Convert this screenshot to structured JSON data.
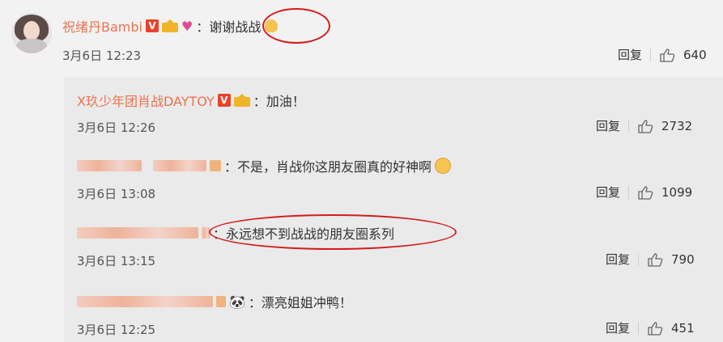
{
  "main": {
    "author": "祝绪丹Bambi",
    "text": "：谢谢战战",
    "time": "3月6日 12:23",
    "reply_label": "回复",
    "likes": "640"
  },
  "replies": [
    {
      "author": "X玖少年团肖战DAYTOY",
      "text": "：加油！",
      "time": "3月6日 12:26",
      "reply_label": "回复",
      "likes": "2732"
    },
    {
      "author": "",
      "text": "：不是，肖战你这朋友圈真的好神啊",
      "time": "3月6日 13:08",
      "reply_label": "回复",
      "likes": "1099"
    },
    {
      "author": "",
      "text": "：永远想不到战战的朋友圈系列",
      "time": "3月6日 13:15",
      "reply_label": "回复",
      "likes": "790"
    },
    {
      "author": "",
      "text": "：漂亮姐姐冲鸭！",
      "time": "3月6日 12:25",
      "reply_label": "回复",
      "likes": "451"
    }
  ],
  "colors": {
    "username": "#eb7350",
    "annotation": "#d31c1c",
    "reply_bg": "#eaeaea",
    "page_bg": "#f2f2f2"
  },
  "icons": [
    "verified-v-icon",
    "crown-badge-icon",
    "heart-badge-icon",
    "clap-emoji-icon",
    "laugh-cry-emoji-icon",
    "panda-emoji-icon",
    "thumbs-up-icon"
  ]
}
